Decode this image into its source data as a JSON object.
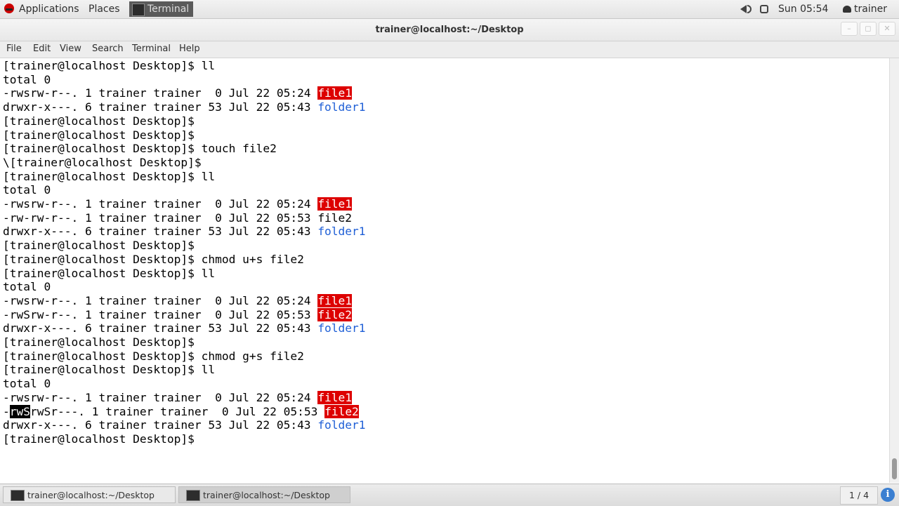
{
  "top_panel": {
    "applications": "Applications",
    "places": "Places",
    "running_app": "Terminal",
    "clock": "Sun 05:54",
    "user": "trainer"
  },
  "window": {
    "title": "trainer@localhost:~/Desktop"
  },
  "menubar": {
    "items": [
      "File",
      "Edit",
      "View",
      "Search",
      "Terminal",
      "Help"
    ]
  },
  "terminal": {
    "lines": [
      {
        "text": "[trainer@localhost Desktop]$ ll"
      },
      {
        "text": "total 0"
      },
      {
        "pre": "-rwsrw-r--. 1 trainer trainer  0 Jul 22 05:24 ",
        "name": "file1",
        "kind": "suid"
      },
      {
        "pre": "drwxr-x---. 6 trainer trainer 53 Jul 22 05:43 ",
        "name": "folder1",
        "kind": "dir"
      },
      {
        "text": "[trainer@localhost Desktop]$"
      },
      {
        "text": "[trainer@localhost Desktop]$"
      },
      {
        "text": "[trainer@localhost Desktop]$ touch file2"
      },
      {
        "text": "\\[trainer@localhost Desktop]$"
      },
      {
        "text": "[trainer@localhost Desktop]$ ll"
      },
      {
        "text": "total 0"
      },
      {
        "pre": "-rwsrw-r--. 1 trainer trainer  0 Jul 22 05:24 ",
        "name": "file1",
        "kind": "suid"
      },
      {
        "pre": "-rw-rw-r--. 1 trainer trainer  0 Jul 22 05:53 ",
        "name": "file2",
        "kind": "plain"
      },
      {
        "pre": "drwxr-x---. 6 trainer trainer 53 Jul 22 05:43 ",
        "name": "folder1",
        "kind": "dir"
      },
      {
        "text": "[trainer@localhost Desktop]$"
      },
      {
        "text": "[trainer@localhost Desktop]$ chmod u+s file2"
      },
      {
        "text": "[trainer@localhost Desktop]$ ll"
      },
      {
        "text": "total 0"
      },
      {
        "pre": "-rwsrw-r--. 1 trainer trainer  0 Jul 22 05:24 ",
        "name": "file1",
        "kind": "suid"
      },
      {
        "pre": "-rwSrw-r--. 1 trainer trainer  0 Jul 22 05:53 ",
        "name": "file2",
        "kind": "suid"
      },
      {
        "pre": "drwxr-x---. 6 trainer trainer 53 Jul 22 05:43 ",
        "name": "folder1",
        "kind": "dir"
      },
      {
        "text": "[trainer@localhost Desktop]$"
      },
      {
        "text": "[trainer@localhost Desktop]$ chmod g+s file2"
      },
      {
        "text": "[trainer@localhost Desktop]$ ll"
      },
      {
        "text": "total 0"
      },
      {
        "pre": "-rwsrw-r--. 1 trainer trainer  0 Jul 22 05:24 ",
        "name": "file1",
        "kind": "suid"
      },
      {
        "sel_pre": "-",
        "sel": "rwS",
        "pre": "rwSr---. 1 trainer trainer  0 Jul 22 05:53 ",
        "name": "file2",
        "kind": "suid"
      },
      {
        "pre": "drwxr-x---. 6 trainer trainer 53 Jul 22 05:43 ",
        "name": "folder1",
        "kind": "dir"
      },
      {
        "text": "[trainer@localhost Desktop]$"
      }
    ]
  },
  "taskbar": {
    "tasks": [
      "trainer@localhost:~/Desktop",
      "trainer@localhost:~/Desktop"
    ],
    "workspace": "1 / 4"
  },
  "colors": {
    "suid_highlight": "#dd0000",
    "directory": "#1f5fd6"
  },
  "icons": [
    "redhat-logo-icon",
    "terminal-icon",
    "volume-icon",
    "network-icon",
    "user-icon",
    "minimize-icon",
    "maximize-icon",
    "close-icon",
    "info-icon"
  ]
}
